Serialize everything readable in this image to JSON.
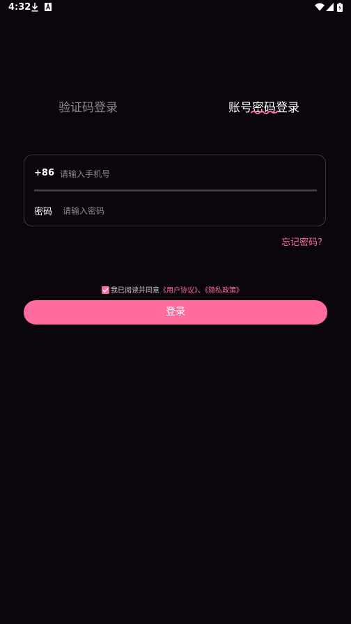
{
  "status_bar": {
    "time": "4:32",
    "left_icons": [
      "download-icon",
      "a-icon"
    ],
    "right_icons": [
      "wifi-icon",
      "signal-icon",
      "battery-icon"
    ]
  },
  "tabs": [
    {
      "label": "验证码登录",
      "active": false
    },
    {
      "label": "账号密码登录",
      "active": true
    }
  ],
  "form": {
    "country_code": "+86",
    "phone_placeholder": "请输入手机号",
    "phone_value": "",
    "password_label": "密码",
    "password_placeholder": "请输入密码",
    "password_value": ""
  },
  "forgot_password": "忘记密码?",
  "agreement": {
    "checked": true,
    "prefix": "我已阅读并同意",
    "user_agreement": "《用户协议》",
    "separator": "、",
    "privacy_policy": "《隐私政策》"
  },
  "login_button": "登录",
  "colors": {
    "background": "#0a060b",
    "accent": "#ff6b9e",
    "inactive_tab": "#8a8a8a",
    "field_border": "#3a3a3e"
  }
}
